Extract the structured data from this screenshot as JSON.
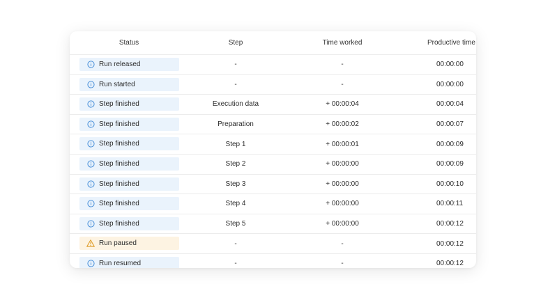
{
  "table": {
    "headers": {
      "status": "Status",
      "step": "Step",
      "time_worked": "Time worked",
      "productive_time": "Productive time"
    },
    "rows": [
      {
        "status": "Run released",
        "status_type": "info",
        "step": "-",
        "time_worked": "-",
        "productive_time": "00:00:00"
      },
      {
        "status": "Run started",
        "status_type": "info",
        "step": "-",
        "time_worked": "-",
        "productive_time": "00:00:00"
      },
      {
        "status": "Step finished",
        "status_type": "info",
        "step": "Execution data",
        "time_worked": "+ 00:00:04",
        "productive_time": "00:00:04"
      },
      {
        "status": "Step finished",
        "status_type": "info",
        "step": "Preparation",
        "time_worked": "+ 00:00:02",
        "productive_time": "00:00:07"
      },
      {
        "status": "Step finished",
        "status_type": "info",
        "step": "Step 1",
        "time_worked": "+ 00:00:01",
        "productive_time": "00:00:09"
      },
      {
        "status": "Step finished",
        "status_type": "info",
        "step": "Step 2",
        "time_worked": "+ 00:00:00",
        "productive_time": "00:00:09"
      },
      {
        "status": "Step finished",
        "status_type": "info",
        "step": "Step 3",
        "time_worked": "+ 00:00:00",
        "productive_time": "00:00:10"
      },
      {
        "status": "Step finished",
        "status_type": "info",
        "step": "Step 4",
        "time_worked": "+ 00:00:00",
        "productive_time": "00:00:11"
      },
      {
        "status": "Step finished",
        "status_type": "info",
        "step": "Step 5",
        "time_worked": "+ 00:00:00",
        "productive_time": "00:00:12"
      },
      {
        "status": "Run paused",
        "status_type": "warn",
        "step": "-",
        "time_worked": "-",
        "productive_time": "00:00:12"
      },
      {
        "status": "Run resumed",
        "status_type": "info",
        "step": "-",
        "time_worked": "-",
        "productive_time": "00:00:12"
      }
    ]
  },
  "icons": {
    "info": "info-icon",
    "warn": "warning-icon"
  },
  "colors": {
    "info_badge_bg": "#eaf3fc",
    "info_icon": "#4a90d9",
    "warn_badge_bg": "#fdf3e2",
    "warn_icon": "#e0a030"
  }
}
